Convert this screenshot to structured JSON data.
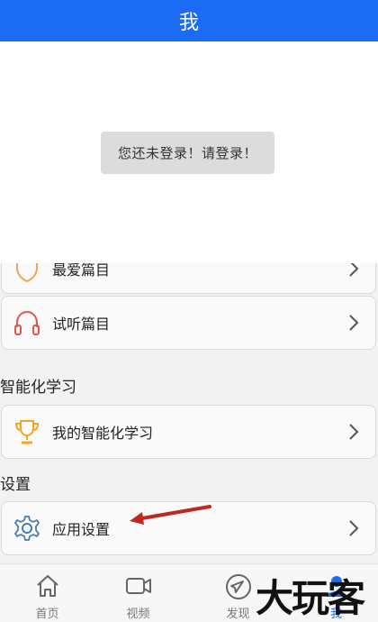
{
  "header": {
    "title": "我"
  },
  "toast": {
    "text": "您还未登录！请登录！"
  },
  "menu": {
    "favorites": "最爱篇目",
    "listened": "试听篇目",
    "smart_section": "智能化学习",
    "my_smart": "我的智能化学习",
    "settings_section": "设置",
    "app_settings": "应用设置"
  },
  "tabs": [
    {
      "label": "首页",
      "icon": "home-icon"
    },
    {
      "label": "视频",
      "icon": "video-icon"
    },
    {
      "label": "发现",
      "icon": "compass-icon"
    },
    {
      "label": "我",
      "icon": "user-icon",
      "active": true
    }
  ],
  "colors": {
    "header": "#1b6cf2",
    "heart": "#f0a35a",
    "headphone": "#e2574c",
    "trophy": "#f5a623",
    "gear": "#4a7ab5",
    "arrow": "#c0281f"
  },
  "watermark": "大玩客"
}
